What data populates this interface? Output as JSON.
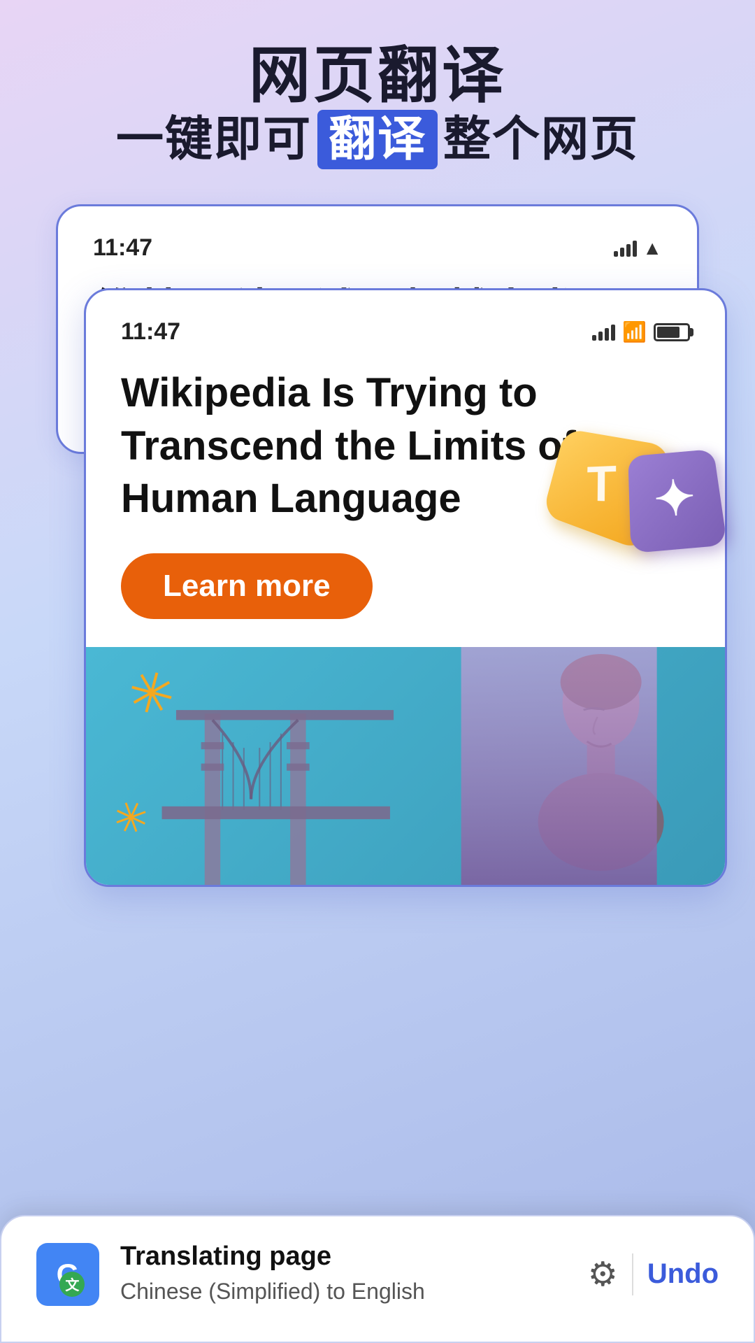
{
  "page": {
    "background": "linear-gradient(160deg, #e8d5f5, #c8d8f8, #b8c8f0)",
    "title": {
      "main": "网页翻译",
      "sub_prefix": "一键即可",
      "sub_highlight": "翻译",
      "sub_suffix": "整个网页"
    },
    "card_back": {
      "time": "11:47",
      "headline_zh": "维基百科正试图超越人类语言的限制"
    },
    "card_front": {
      "time": "11:47",
      "headline_en": "Wikipedia Is Trying to Transcend the Limits of Human Language",
      "learn_more_label": "Learn more",
      "image_alt": "Article image with bridge and person portrait"
    },
    "translation_bar": {
      "status_label": "Translating page",
      "subtitle": "Chinese (Simplified) to English",
      "settings_label": "Settings",
      "undo_label": "Undo"
    },
    "icons": {
      "google_translate": "G",
      "gear": "⚙",
      "snowflake1": "✳",
      "snowflake2": "✳"
    }
  }
}
